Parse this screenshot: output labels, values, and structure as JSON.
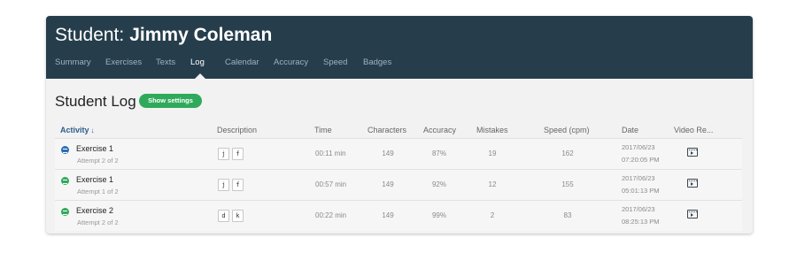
{
  "header": {
    "title_prefix": "Student:",
    "student_name": "Jimmy Coleman",
    "tabs": [
      {
        "label": "Summary"
      },
      {
        "label": "Exercises"
      },
      {
        "label": "Texts"
      },
      {
        "label": "Log",
        "active": true
      },
      {
        "label": "Calendar"
      },
      {
        "label": "Accuracy"
      },
      {
        "label": "Speed"
      },
      {
        "label": "Badges"
      }
    ]
  },
  "log": {
    "title": "Student Log",
    "settings_button": "Show settings",
    "columns": [
      "Activity",
      "Description",
      "Time",
      "Characters",
      "Accuracy",
      "Mistakes",
      "Speed (cpm)",
      "Date",
      "Video Re..."
    ],
    "sort_indicator": "↓",
    "rows": [
      {
        "activity": "Exercise 1",
        "attempt": "Attempt 2 of 2",
        "icon_color": "#2d6fb6",
        "keys": [
          "j",
          "f"
        ],
        "time": "00:11 min",
        "characters": "149",
        "accuracy": "87%",
        "mistakes": "19",
        "speed": "162",
        "date": "2017/06/23",
        "clock": "07:20:05 PM"
      },
      {
        "activity": "Exercise 1",
        "attempt": "Attempt 1 of 2",
        "icon_color": "#2faa5b",
        "keys": [
          "j",
          "f"
        ],
        "time": "00:57 min",
        "characters": "149",
        "accuracy": "92%",
        "mistakes": "12",
        "speed": "155",
        "date": "2017/06/23",
        "clock": "05:01:13 PM"
      },
      {
        "activity": "Exercise 2",
        "attempt": "Attempt 2 of 2",
        "icon_color": "#2faa5b",
        "keys": [
          "d",
          "k"
        ],
        "time": "00:22 min",
        "characters": "149",
        "accuracy": "99%",
        "mistakes": "2",
        "speed": "83",
        "date": "2017/06/23",
        "clock": "08:25:13 PM"
      }
    ]
  },
  "colors": {
    "header_bg": "#263e4c",
    "accent_green": "#2faa5b",
    "accent_blue": "#2d6fb6"
  },
  "icons": [
    "exercise-icon",
    "sort-down-icon",
    "video-replay-icon"
  ]
}
